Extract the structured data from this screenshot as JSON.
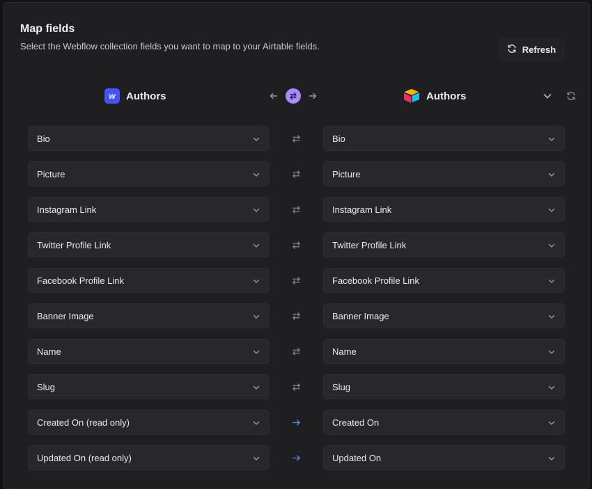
{
  "header": {
    "title": "Map fields",
    "subtitle": "Select the Webflow collection fields you want to map to your Airtable fields.",
    "refresh_label": "Refresh"
  },
  "columns": {
    "left": {
      "source": "Webflow",
      "logo_letter": "w",
      "name": "Authors"
    },
    "right": {
      "source": "Airtable",
      "name": "Authors"
    }
  },
  "colors": {
    "accent_toggle": "#a78bfa",
    "oneway_arrow": "#5b8def",
    "webflow_brand": "#4353ff"
  },
  "rows": [
    {
      "left": "Bio",
      "right": "Bio",
      "direction": "two-way"
    },
    {
      "left": "Picture",
      "right": "Picture",
      "direction": "two-way"
    },
    {
      "left": "Instagram Link",
      "right": "Instagram Link",
      "direction": "two-way"
    },
    {
      "left": "Twitter Profile Link",
      "right": "Twitter Profile Link",
      "direction": "two-way"
    },
    {
      "left": "Facebook Profile Link",
      "right": "Facebook Profile Link",
      "direction": "two-way"
    },
    {
      "left": "Banner Image",
      "right": "Banner Image",
      "direction": "two-way"
    },
    {
      "left": "Name",
      "right": "Name",
      "direction": "two-way"
    },
    {
      "left": "Slug",
      "right": "Slug",
      "direction": "two-way"
    },
    {
      "left": "Created On (read only)",
      "right": "Created On",
      "direction": "one-way"
    },
    {
      "left": "Updated On (read only)",
      "right": "Updated On",
      "direction": "one-way"
    }
  ]
}
